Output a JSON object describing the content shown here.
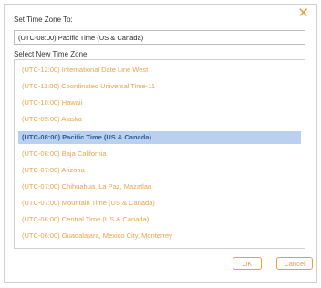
{
  "dialog": {
    "set_label": "Set Time Zone To:",
    "current_value": "(UTC-08:00) Pacific Time (US & Canada)",
    "new_label": "Select New Time Zone:",
    "close_glyph": "✕"
  },
  "timezones": [
    "(UTC-12:00) International Date Line West",
    "(UTC-11:00) Coordinated Universal Time-11",
    "(UTC-10:00) Hawaii",
    "(UTC-09:00) Alaska",
    "(UTC-08:00) Pacific Time (US & Canada)",
    "(UTC-08:00) Baja California",
    "(UTC-07:00) Arizona",
    "(UTC-07:00) Chihuahua, La Paz, Mazatlan",
    "(UTC-07:00) Mountain Time (US & Canada)",
    "(UTC-06:00) Central Time (US & Canada)",
    "(UTC-06:00) Guadalajara, Mexico City, Monterrey"
  ],
  "selected_index": 4,
  "buttons": {
    "ok": "OK",
    "cancel": "Cancel"
  },
  "colors": {
    "accent": "#e3a23b",
    "selected_bg": "#b9d1ee",
    "selected_text": "#2c5aa0"
  }
}
